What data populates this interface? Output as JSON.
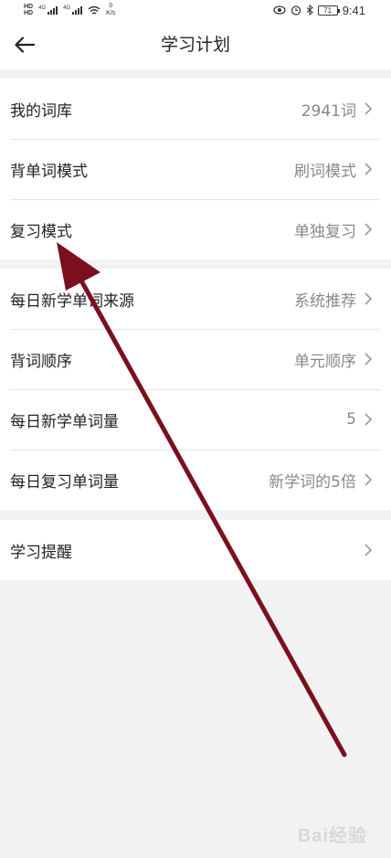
{
  "status_bar": {
    "network_top": "HD",
    "network_bottom": "HD",
    "signal1_label": "4G",
    "signal2_label": "4G",
    "speed_value": "0",
    "speed_unit": "K/s",
    "battery": "71",
    "time": "9:41",
    "icons": [
      "eye-icon",
      "alarm-icon",
      "bluetooth-icon",
      "battery-icon"
    ]
  },
  "header": {
    "title": "学习计划",
    "back_icon": "arrow-left-icon"
  },
  "groups": [
    {
      "rows": [
        {
          "label": "我的词库",
          "value": "2941词"
        },
        {
          "label": "背单词模式",
          "value": "刷词模式"
        },
        {
          "label": "复习模式",
          "value": "单独复习"
        }
      ]
    },
    {
      "rows": [
        {
          "label": "每日新学单词来源",
          "value": "系统推荐"
        },
        {
          "label": "背词顺序",
          "value": "单元顺序"
        },
        {
          "label": "每日新学单词量",
          "value": "5"
        },
        {
          "label": "每日复习单词量",
          "value": "新学词的5倍"
        }
      ]
    },
    {
      "rows": [
        {
          "label": "学习提醒",
          "value": ""
        }
      ]
    }
  ],
  "watermark": "Bai经验",
  "colors": {
    "background": "#f2f2f2",
    "card": "#ffffff",
    "annotation_arrow": "#7a0f1e",
    "value_text": "#888888"
  }
}
